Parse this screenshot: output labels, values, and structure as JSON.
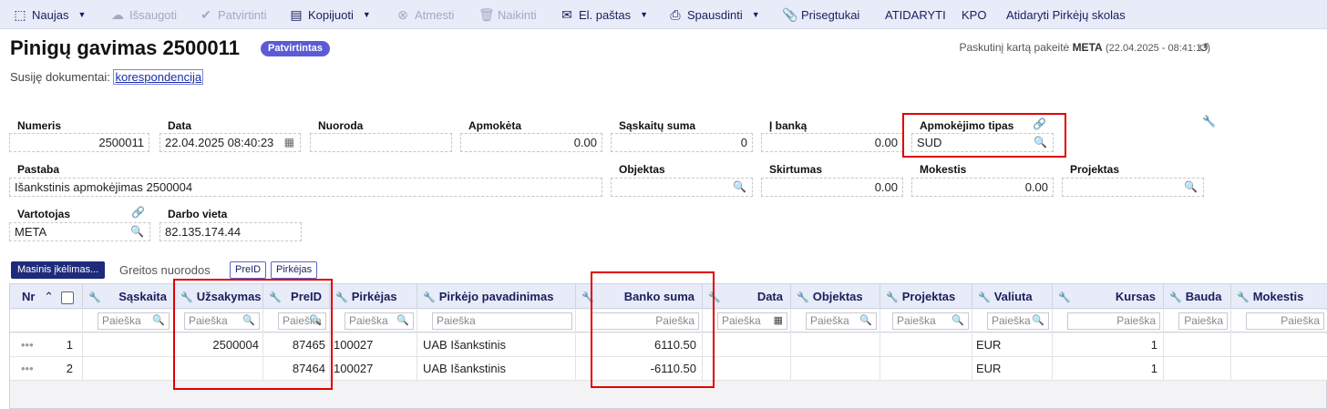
{
  "toolbar": {
    "new": "Naujas",
    "save": "Išsaugoti",
    "confirm": "Patvirtinti",
    "copy": "Kopijuoti",
    "reject": "Atmesti",
    "delete": "Naikinti",
    "email": "El. paštas",
    "print": "Spausdinti",
    "attachments": "Prisegtukai",
    "open": "ATIDARYTI",
    "kpo": "KPO",
    "open_debts": "Atidaryti Pirkėjų skolas"
  },
  "header": {
    "title": "Pinigų gavimas 2500011",
    "status": "Patvirtintas",
    "lastmod_prefix": "Paskutinį kartą pakeitė",
    "lastmod_user": "META",
    "lastmod_time": "(22.04.2025 - 08:41:13)",
    "related_label": "Susiję dokumentai:",
    "related_link": "korespondencija"
  },
  "form": {
    "numeris_label": "Numeris",
    "numeris": "2500011",
    "data_label": "Data",
    "data": "22.04.2025 08:40:23",
    "nuoroda_label": "Nuoroda",
    "nuoroda": "",
    "apmoketa_label": "Apmokėta",
    "apmoketa": "0.00",
    "saskaitu_suma_label": "Sąskaitų suma",
    "saskaitu_suma": "0",
    "i_banka_label": "Į banką",
    "i_banka": "0.00",
    "apmokejimo_tipas_label": "Apmokėjimo tipas",
    "apmokejimo_tipas": "SUD",
    "pastaba_label": "Pastaba",
    "pastaba": "Išankstinis apmokėjimas 2500004",
    "objektas_label": "Objektas",
    "objektas": "",
    "skirtumas_label": "Skirtumas",
    "skirtumas": "0.00",
    "mokestis_label": "Mokestis",
    "mokestis": "0.00",
    "projektas_label": "Projektas",
    "projektas": "",
    "vartotojas_label": "Vartotojas",
    "vartotojas": "META",
    "darbo_vieta_label": "Darbo vieta",
    "darbo_vieta": "82.135.174.44"
  },
  "grid_toolbar": {
    "bulk": "Masinis įkėlimas...",
    "quick_links": "Greitos nuorodos",
    "prelid": "PreID",
    "pirkejas": "Pirkėjas"
  },
  "grid": {
    "columns": {
      "nr": "Nr",
      "saskaita": "Sąskaita",
      "uzsakymas": "Užsakymas",
      "prelid": "PreID",
      "pirkejas": "Pirkėjas",
      "pirkejo_pavadinimas": "Pirkėjo pavadinimas",
      "banko_suma": "Banko suma",
      "data": "Data",
      "objektas": "Objektas",
      "projektas": "Projektas",
      "valiuta": "Valiuta",
      "kursas": "Kursas",
      "bauda": "Bauda",
      "mokestis": "Mokestis"
    },
    "search_placeholder": "Paieška",
    "rows": [
      {
        "nr": "1",
        "uzsakymas": "2500004",
        "prelid": "87465",
        "pirkejas": "100027",
        "pavadinimas": "UAB Išankstinis",
        "banko_suma": "6110.50",
        "valiuta": "EUR",
        "kursas": "1"
      },
      {
        "nr": "2",
        "uzsakymas": "",
        "prelid": "87464",
        "pirkejas": "100027",
        "pavadinimas": "UAB Išankstinis",
        "banko_suma": "-6110.50",
        "valiuta": "EUR",
        "kursas": "1"
      }
    ]
  },
  "colors": {
    "toolbar_bg": "#e8ebf8",
    "status_badge": "#5b5bd6",
    "highlight_box": "#e00000",
    "primary_button": "#1e2a7a"
  }
}
